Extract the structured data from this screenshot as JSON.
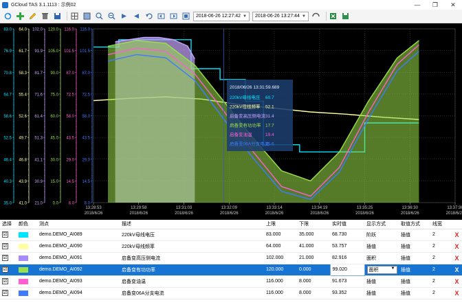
{
  "window": {
    "title": "GCloud TAS 3.1.1113 : 示例02",
    "min": "—",
    "restore": "❐",
    "close": "✕"
  },
  "toolbar": {
    "start_time": "2018-06-26 12:27:42",
    "end_time": "2018-06-26 13:27:44",
    "icons": [
      "refresh-icon",
      "add-icon",
      "edit-icon",
      "delete-icon",
      "save-icon",
      "grid-icon",
      "layout-icon",
      "zoom-in-icon",
      "zoom-out-icon",
      "forward-icon",
      "back-icon",
      "undo-icon",
      "pan-left-icon",
      "pan-right-icon",
      "fit-icon",
      "swap-icon",
      "excel-icon",
      "save-disk-icon"
    ]
  },
  "tooltip": {
    "time": "2018/06/26 13:31:59.689",
    "lines": [
      {
        "label": "220kV母线电压",
        "value": "60.7",
        "color": "#00e5ff"
      },
      {
        "label": "220kV母线频率",
        "value": "52.1",
        "color": "#ffffa0"
      },
      {
        "label": "启备变高压侧电流",
        "value": "31.4",
        "color": "#c9a6ff"
      },
      {
        "label": "启备变有功功率",
        "value": "17.7",
        "color": "#9be04a"
      },
      {
        "label": "启备变油温",
        "value": "19.4",
        "color": "#ff5fcf"
      },
      {
        "label": "启备变06A分支电流",
        "value": "15.6",
        "color": "#3d7bff"
      }
    ]
  },
  "chart_data": {
    "type": "line",
    "x_ticks": [
      {
        "time": "13:28:53",
        "date": "2018/6/26"
      },
      {
        "time": "13:29:58",
        "date": "2018/6/26"
      },
      {
        "time": "13:31:03",
        "date": "2018/6/26"
      },
      {
        "time": "13:32:09",
        "date": "2018/6/26"
      },
      {
        "time": "13:33:14",
        "date": "2018/6/26"
      },
      {
        "time": "13:34:19",
        "date": "2018/6/26"
      },
      {
        "time": "13:35:25",
        "date": "2018/6/26"
      },
      {
        "time": "13:36:30",
        "date": "2018/6/26"
      },
      {
        "time": "13:37:36",
        "date": "2018/6/26"
      }
    ],
    "axes": [
      {
        "color": "#00e5ff",
        "ticks": [
          "83.0",
          "76.9",
          "70.8",
          "64.7",
          "58.6",
          "52.5",
          "46.4",
          "40.3",
          "35.0"
        ],
        "range": [
          35,
          83
        ]
      },
      {
        "color": "#ffffa0",
        "ticks": [
          "64.0",
          "61.7",
          "58.3",
          "55.4",
          "52.6",
          "49.7",
          "46.8",
          "43.9",
          "41.0"
        ],
        "range": [
          41,
          64
        ]
      },
      {
        "color": "#c9a6ff",
        "ticks": [
          "102.0",
          "91.9",
          "81.7",
          "71.6",
          "61.4",
          "51.3",
          "41.1",
          "30.9",
          "21.0"
        ],
        "range": [
          21,
          102
        ]
      },
      {
        "color": "#9be04a",
        "ticks": [
          "120.0",
          "105.0",
          "90.0",
          "75.0",
          "60.0",
          "45.0",
          "30.0",
          "15.0",
          "0.0"
        ],
        "range": [
          0,
          120
        ]
      },
      {
        "color": "#ff5fcf",
        "ticks": [
          "116.0",
          "101.5",
          "87.0",
          "72.5",
          "58.0",
          "43.5",
          "29.0",
          "14.5",
          "8.0"
        ],
        "range": [
          8,
          116
        ]
      },
      {
        "color": "#3d7bff",
        "ticks": [
          "116.0",
          "101.5",
          "87.0",
          "72.5",
          "58.0",
          "43.5",
          "29.0",
          "14.5",
          "8.0"
        ],
        "range": [
          8,
          116
        ]
      }
    ],
    "series": [
      {
        "name": "220kV母线电压",
        "color": "#00e5ff",
        "type": "step",
        "x": [
          0,
          0.07,
          0.07,
          0.27,
          0.27,
          0.35,
          0.35,
          0.42,
          0.42,
          0.47,
          0.47,
          0.57,
          0.57,
          0.75,
          0.75,
          0.9
        ],
        "values": [
          78,
          78,
          80,
          80,
          72,
          72,
          69,
          69,
          63,
          63,
          51,
          51,
          49,
          49,
          57,
          57
        ]
      },
      {
        "name": "220kV母线频率",
        "color": "#ffffa0",
        "type": "line",
        "x": [
          0,
          0.1,
          0.2,
          0.3,
          0.4,
          0.5,
          0.6,
          0.7,
          0.8,
          0.9
        ],
        "values": [
          54.5,
          54.8,
          55.0,
          54.7,
          54.0,
          53.5,
          53.0,
          52.7,
          52.3,
          52.0
        ]
      },
      {
        "name": "启备变高压侧电流",
        "color": "#c9a6ff",
        "type": "area",
        "x": [
          0.06,
          0.1,
          0.14,
          0.18,
          0.22,
          0.26,
          0.28
        ],
        "values": [
          96,
          97,
          98,
          98,
          97,
          94,
          88
        ]
      },
      {
        "name": "启备变有功功率",
        "color": "#9be04a",
        "type": "area",
        "x": [
          0.04,
          0.12,
          0.2,
          0.28,
          0.36,
          0.44,
          0.52,
          0.6,
          0.68,
          0.76,
          0.84,
          0.9
        ],
        "values": [
          108,
          112,
          110,
          95,
          70,
          45,
          22,
          15,
          35,
          70,
          100,
          112
        ]
      },
      {
        "name": "启备变油温",
        "color": "#ff5fcf",
        "type": "line",
        "x": [
          0.04,
          0.12,
          0.2,
          0.28,
          0.36,
          0.44,
          0.52,
          0.6,
          0.68,
          0.76,
          0.84,
          0.9
        ],
        "values": [
          100,
          104,
          102,
          88,
          65,
          40,
          18,
          12,
          30,
          64,
          94,
          106
        ]
      },
      {
        "name": "启备变06A分支电流",
        "color": "#3d7bff",
        "type": "line",
        "x": [
          0.04,
          0.12,
          0.2,
          0.28,
          0.36,
          0.44,
          0.52,
          0.6,
          0.68,
          0.76,
          0.84,
          0.9
        ],
        "values": [
          96,
          100,
          98,
          84,
          60,
          36,
          15,
          10,
          27,
          60,
          90,
          102
        ]
      }
    ]
  },
  "grid": {
    "headers": [
      "选择",
      "颜色",
      "测点",
      "描述",
      "上限",
      "下限",
      "实时值",
      "显示方式",
      "取值方式",
      "线宽",
      ""
    ],
    "rows": [
      {
        "checked": "☑",
        "color": "#00e5ff",
        "point": "demo.DEMO_AI089",
        "desc": "220kV母线电压",
        "upper": "83.000",
        "lower": "35.000",
        "value": "68.730",
        "display": "阶跃",
        "mode": "插值",
        "width": "2",
        "del": "X",
        "selected": false
      },
      {
        "checked": "☑",
        "color": "#ffffa0",
        "point": "demo.DEMO_AI090",
        "desc": "220kV母线频率",
        "upper": "64.000",
        "lower": "41.000",
        "value": "53.757",
        "display": "插值",
        "mode": "插值",
        "width": "2",
        "del": "X",
        "selected": false
      },
      {
        "checked": "☑",
        "color": "#a78bfa",
        "point": "demo.DEMO_AI091",
        "desc": "启备变高压侧电流",
        "upper": "102.000",
        "lower": "21.000",
        "value": "82.916",
        "display": "面积",
        "mode": "插值",
        "width": "2",
        "del": "X",
        "selected": false
      },
      {
        "checked": "☑",
        "color": "#9be04a",
        "point": "demo.DEMO_AI092",
        "desc": "启备变有功功率",
        "upper": "120.000",
        "lower": "0.000",
        "value": "99.020",
        "display": "面积",
        "mode": "插值",
        "width": "2",
        "del": "X",
        "selected": true
      },
      {
        "checked": "☑",
        "color": "#ff5fcf",
        "point": "demo.DEMO_AI093",
        "desc": "启备变油温",
        "upper": "116.000",
        "lower": "8.000",
        "value": "91.673",
        "display": "插值",
        "mode": "插值",
        "width": "2",
        "del": "X",
        "selected": false
      },
      {
        "checked": "☑",
        "color": "#3d7bff",
        "point": "demo.DEMO_AI094",
        "desc": "启备变06A分支电流",
        "upper": "116.000",
        "lower": "8.000",
        "value": "93.352",
        "display": "插值",
        "mode": "插值",
        "width": "2",
        "del": "X",
        "selected": false
      }
    ]
  }
}
